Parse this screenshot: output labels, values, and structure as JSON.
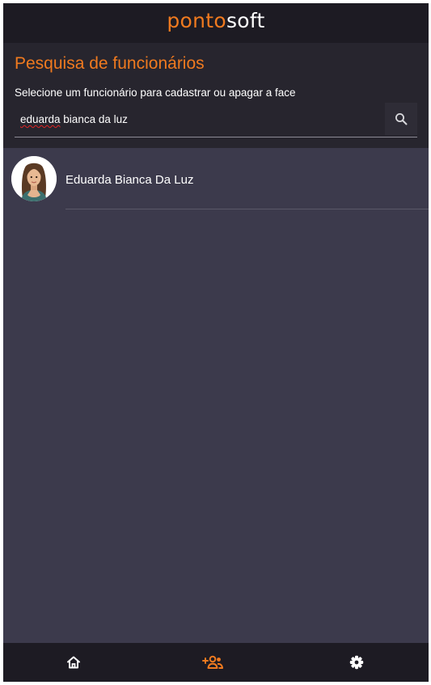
{
  "app": {
    "logo": {
      "part1": "ponto",
      "part2": "soft"
    }
  },
  "header": {
    "title": "Pesquisa de funcionários",
    "subtitle": "Selecione um funcionário para cadastrar ou apagar a face"
  },
  "search": {
    "misspelled_word": "eduarda",
    "rest_of_value": " bianca da luz",
    "icon": "search-icon"
  },
  "employees": [
    {
      "name": "Eduarda Bianca Da Luz",
      "avatar": "female-avatar"
    }
  ],
  "bottom_nav": [
    {
      "icon": "home-icon",
      "active": false
    },
    {
      "icon": "add-users-icon",
      "active": true
    },
    {
      "icon": "settings-icon",
      "active": false
    }
  ],
  "colors": {
    "accent": "#f07a1f",
    "topbar": "#1d1b23",
    "header": "#27252e",
    "list_background": "#3c3a4c",
    "text": "#ffffff",
    "spellcheck": "#e02424"
  }
}
